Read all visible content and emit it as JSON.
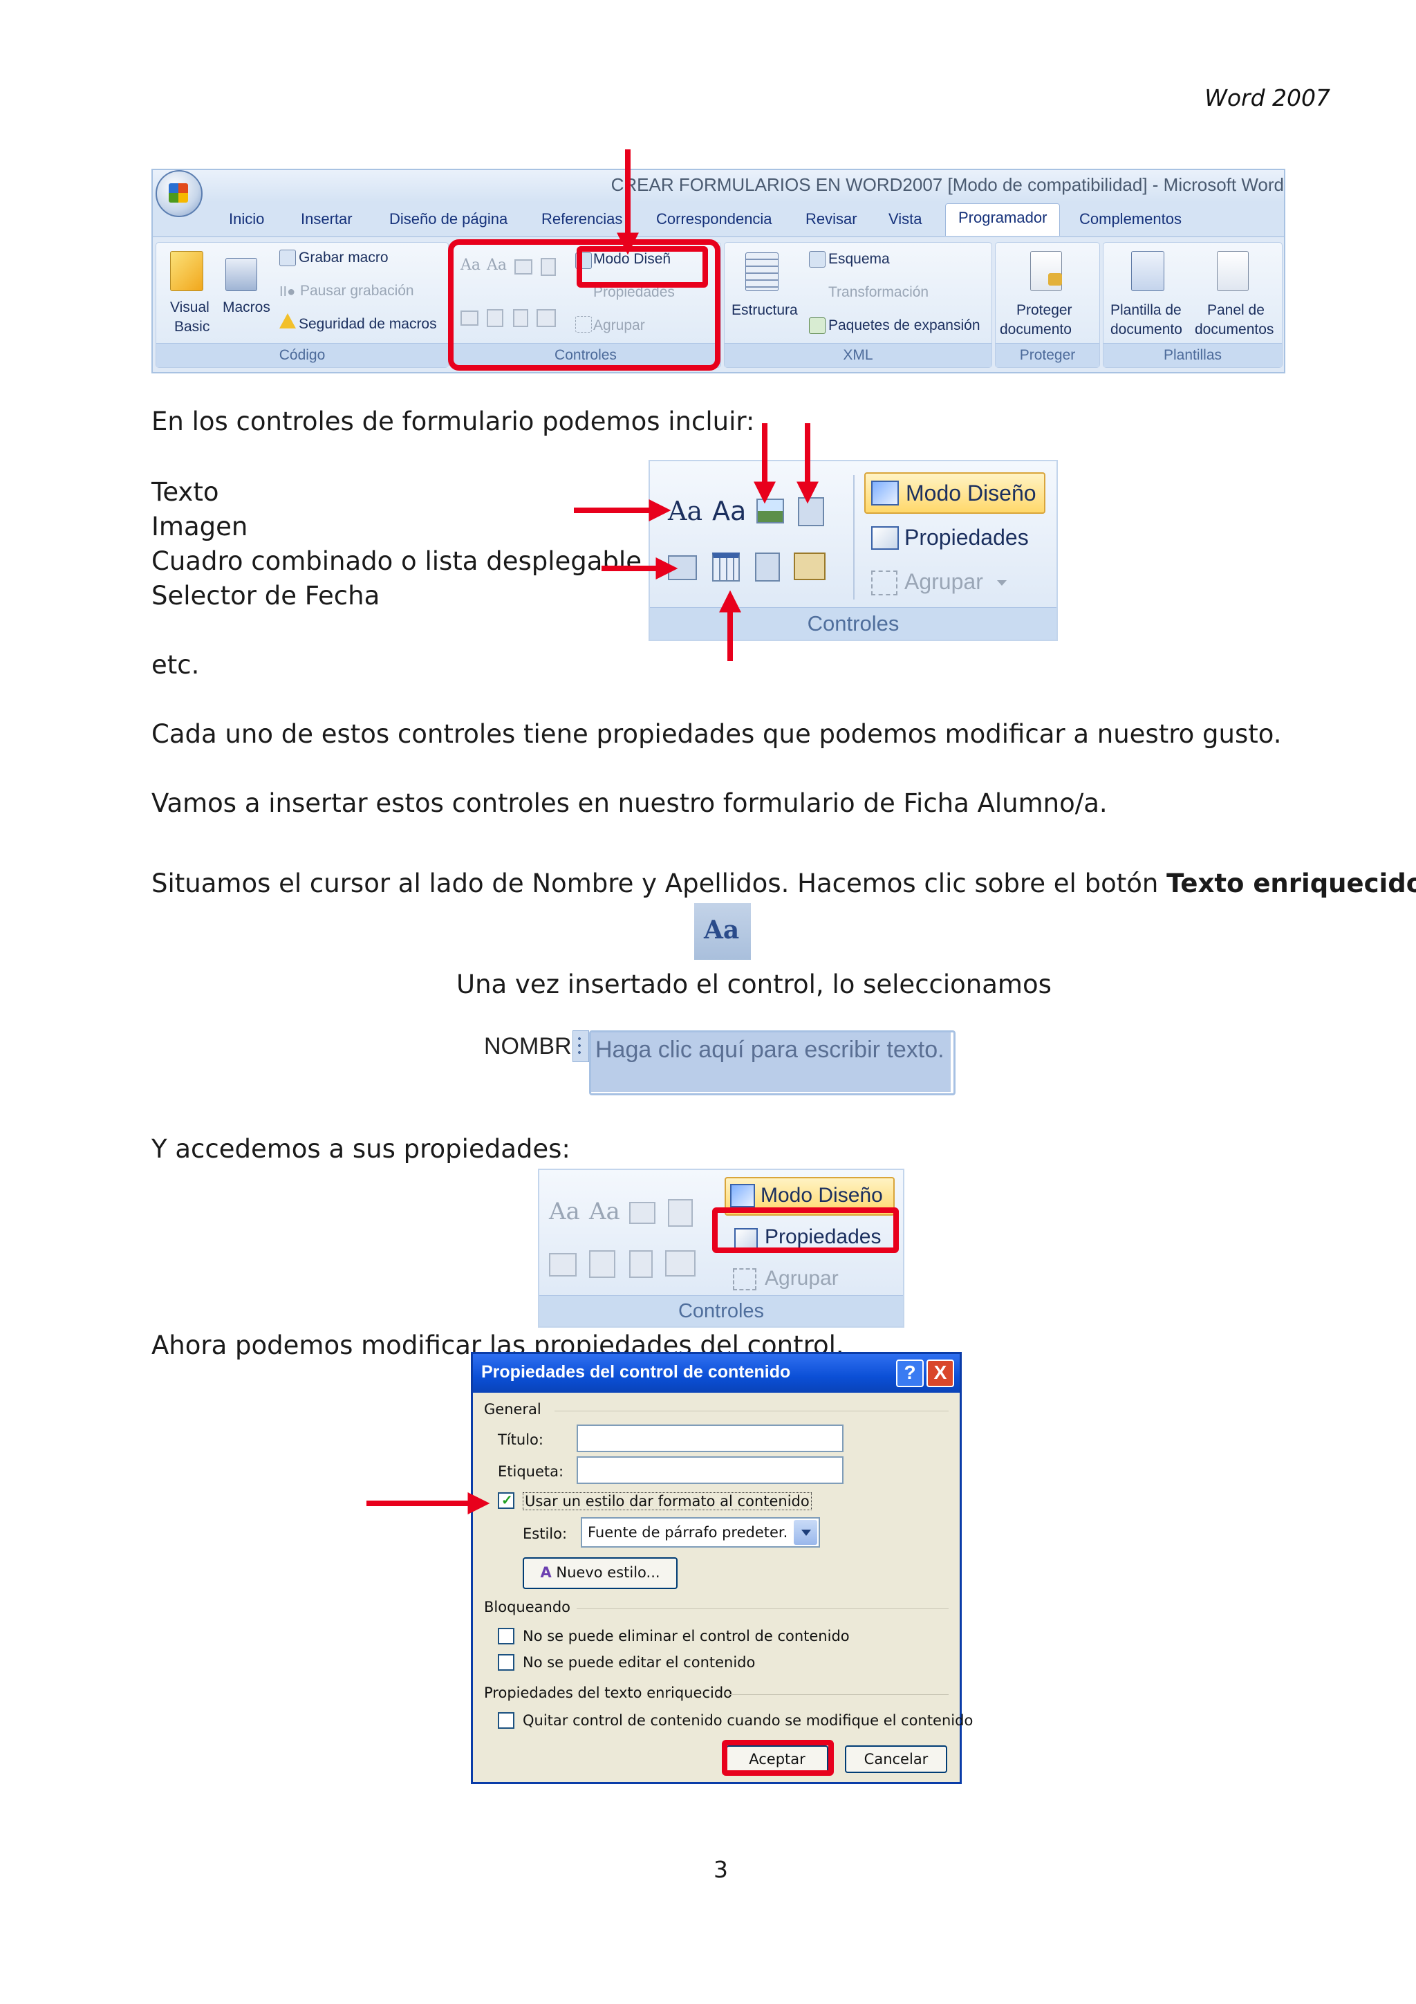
{
  "header": {
    "doc_title": "Word 2007"
  },
  "ribbon": {
    "window_title": "CREAR FORMULARIOS EN WORD2007 [Modo de compatibilidad] - Microsoft Word",
    "tabs": [
      "Inicio",
      "Insertar",
      "Diseño de página",
      "Referencias",
      "Correspondencia",
      "Revisar",
      "Vista",
      "Programador",
      "Complementos"
    ],
    "active_tab": "Programador",
    "codigo": {
      "label": "Código",
      "visual_basic_1": "Visual",
      "visual_basic_2": "Basic",
      "macros": "Macros",
      "grabar_macro": "Grabar macro",
      "pausar_grabacion": "Pausar grabación",
      "seguridad_macros": "Seguridad de macros"
    },
    "controles": {
      "label": "Controles",
      "modo_diseno": "Modo Diseñ",
      "propiedades": "Propiedades",
      "agrupar": "Agrupar"
    },
    "xml": {
      "label": "XML",
      "estructura": "Estructura",
      "esquema": "Esquema",
      "transformacion": "Transformación",
      "paquetes": "Paquetes de expansión"
    },
    "proteger": {
      "label": "Proteger",
      "btn_1": "Proteger",
      "btn_2": "documento"
    },
    "plantillas": {
      "label": "Plantillas",
      "plantilla_1": "Plantilla de",
      "plantilla_2": "documento",
      "panel_1": "Panel de",
      "panel_2": "documentos"
    }
  },
  "intro": {
    "line": "En los controles de formulario podemos incluir:",
    "list": [
      "Texto",
      "Imagen",
      "Cuadro combinado o lista desplegable",
      "Selector de Fecha"
    ],
    "etc": "etc."
  },
  "controls_panel": {
    "aa": "Aa",
    "modo_diseno": "Modo Diseño",
    "propiedades": "Propiedades",
    "agrupar": "Agrupar",
    "label": "Controles"
  },
  "paragraphs": {
    "p1": "Cada uno de estos controles tiene propiedades que podemos modificar a nuestro gusto.",
    "p2": "Vamos a insertar estos controles en nuestro formulario de Ficha Alumno/a.",
    "p3_start": "Situamos el cursor al lado de Nombre y Apellidos. Hacemos clic sobre el botón ",
    "p3_bold": "Texto enriquecido",
    "p4": "Una vez insertado el control, lo seleccionamos",
    "p5": "Y accedemos a sus propiedades:",
    "p6": "Ahora podemos modificar las propiedades del control."
  },
  "rich_text_icon": {
    "label": "Aa"
  },
  "field_demo": {
    "label": "NOMBR",
    "placeholder": "Haga clic aquí para escribir texto."
  },
  "dialog": {
    "title": "Propiedades del control de contenido",
    "help": "?",
    "close": "X",
    "general": "General",
    "titulo_label": "Título:",
    "etiqueta_label": "Etiqueta:",
    "usar_estilo": "Usar un estilo dar formato al contenido",
    "estilo_label": "Estilo:",
    "estilo_value": "Fuente de párrafo predeter.",
    "nuevo_estilo": "Nuevo estilo...",
    "bloqueando": "Bloqueando",
    "no_eliminar": "No se puede eliminar el control de contenido",
    "no_editar": "No se puede editar el contenido",
    "prop_texto": "Propiedades del texto enriquecido",
    "quitar": "Quitar control de contenido cuando se modifique el contenido",
    "aceptar": "Aceptar",
    "cancelar": "Cancelar",
    "usar_estilo_checked": true
  },
  "page_number": "3",
  "colors": {
    "accent_red": "#e8001c",
    "dialog_blue": "#0b4fd6",
    "ribbon_blue": "#dfe9f6"
  }
}
